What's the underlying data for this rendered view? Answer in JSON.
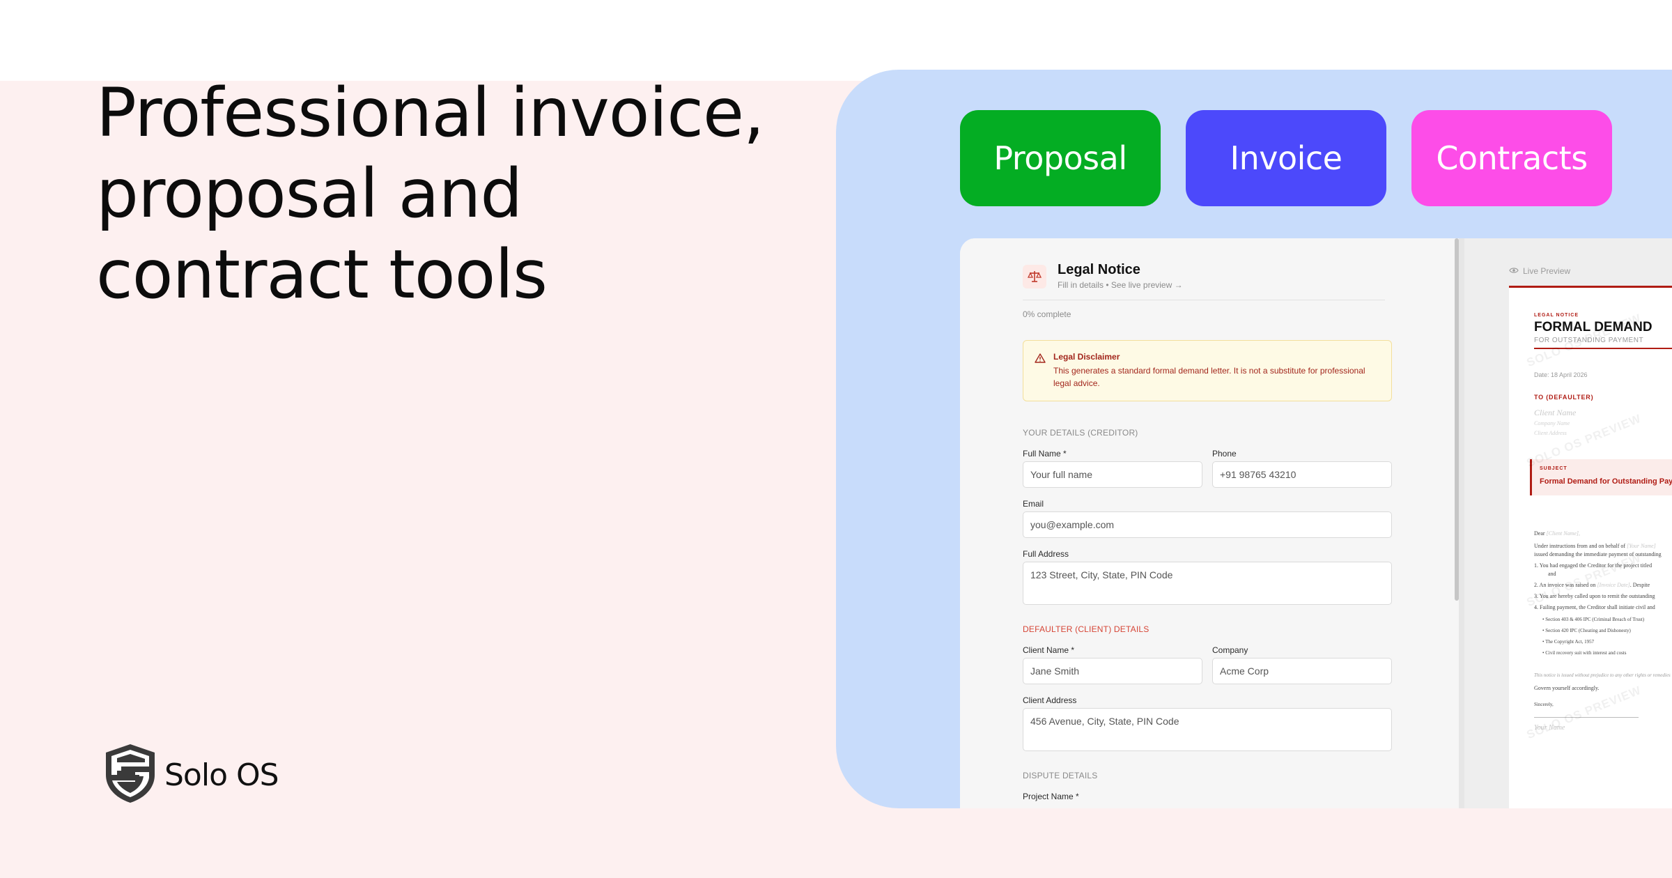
{
  "headline": {
    "line1": "Professional invoice,",
    "line2": "proposal and",
    "line3": "contract tools"
  },
  "brand": {
    "name": "Solo OS",
    "logo_icon": "shield-s-icon"
  },
  "pills": [
    {
      "label": "Proposal",
      "color": "#04ad23"
    },
    {
      "label": "Invoice",
      "color": "#4c49fb"
    },
    {
      "label": "Contracts",
      "color": "#fd4de8"
    }
  ],
  "form": {
    "title": "Legal Notice",
    "subtitle": "Fill in details • See live preview →",
    "progress": "0% complete",
    "disclaimer": {
      "title": "Legal Disclaimer",
      "text": "This generates a standard formal demand letter. It is not a substitute for professional legal advice."
    },
    "section_creditor": "YOUR DETAILS (CREDITOR)",
    "full_name_label": "Full Name *",
    "full_name_placeholder": "Your full name",
    "phone_label": "Phone",
    "phone_placeholder": "+91 98765 43210",
    "email_label": "Email",
    "email_placeholder": "you@example.com",
    "address_label": "Full Address",
    "address_placeholder": "123 Street, City, State, PIN Code",
    "section_defaulter": "DEFAULTER (CLIENT) DETAILS",
    "client_name_label": "Client Name *",
    "client_name_placeholder": "Jane Smith",
    "company_label": "Company",
    "company_placeholder": "Acme Corp",
    "client_address_label": "Client Address",
    "client_address_placeholder": "456 Avenue, City, State, PIN Code",
    "section_dispute": "DISPUTE DETAILS",
    "project_name_label": "Project Name *"
  },
  "preview": {
    "label": "Live Preview",
    "eyebrow": "LEGAL NOTICE",
    "title": "FORMAL DEMAND",
    "subtitle": "FOR OUTSTANDING PAYMENT",
    "date": "Date: 18 April 2026",
    "to_heading": "TO (DEFAULTER)",
    "client_name": "Client Name",
    "company_name": "Company Name",
    "client_address": "Client Address",
    "subject_label": "SUBJECT",
    "subject_text": "Formal Demand for Outstanding Payment",
    "dear": "Dear",
    "dear_name": "[Client Name],",
    "para1a": "Under instructions from and on behalf of",
    "para1b": "[Your Name]",
    "para1c": "issued demanding the immediate payment of outstanding",
    "item1": "1. You had engaged the Creditor for the project titled",
    "item1b": "and",
    "item2a": "2. An invoice was raised on",
    "item2b": "[Invoice Date]",
    "item2c": ". Despite",
    "item3": "3. You are hereby called upon to remit the outstanding",
    "item4": "4. Failing payment, the Creditor shall initiate civil and",
    "bullets": [
      "• Section 403 & 406 IPC (Criminal Breach of Trust)",
      "• Section 420 IPC (Cheating and Dishonesty)",
      "• The Copyright Act, 1957",
      "• Civil recovery suit with interest and costs"
    ],
    "without_prejudice": "This notice is issued without prejudice to any other rights or remedies",
    "govern": "Govern yourself accordingly.",
    "sincerely": "Sincerely,",
    "your_name": "Your Name",
    "watermark": "SOLO OS PREVIEW"
  }
}
